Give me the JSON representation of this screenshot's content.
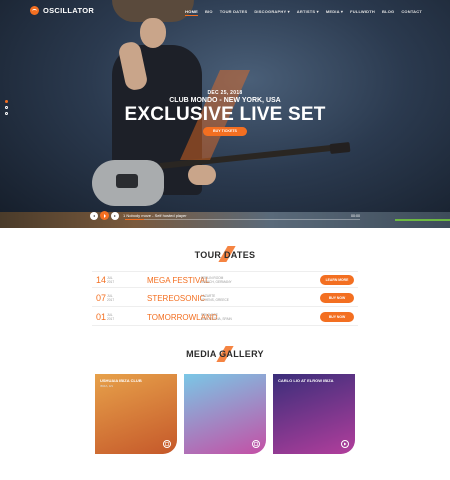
{
  "brand": {
    "name": "OSCILLATOR",
    "accent": "#f36f21"
  },
  "nav": {
    "items": [
      "HOME",
      "BIO",
      "TOUR DATES",
      "DISCOGRAPHY ▾",
      "ARTISTS ▾",
      "MEDIA ▾",
      "FULLWIDTH",
      "BLOG",
      "CONTACT"
    ],
    "active_index": 0
  },
  "hero": {
    "date": "DEC 25, 2018",
    "venue": "CLUB MONDO - NEW YORK, USA",
    "headline": "EXCLUSIVE LIVE SET",
    "cta": "BUY TICKETS",
    "slides": 3,
    "active_slide": 0
  },
  "player": {
    "track": "1 Nobody move - Self hosted player",
    "time": "00:00",
    "progress": 0.08
  },
  "tour": {
    "title": "TOUR DATES",
    "rows": [
      {
        "day": "14",
        "month": "JUL",
        "year": "2017",
        "name": "MEGA FESTIVAL",
        "location_line1": "BERLIN ROOM",
        "location_line2": "MUNICH, GERMANY",
        "button": "LEARN MORE"
      },
      {
        "day": "07",
        "month": "JUL",
        "year": "2017",
        "name": "STEREOSONIC",
        "location_line1": "LAZARTE",
        "location_line2": "ATHENS, GREECE",
        "button": "BUY NOW"
      },
      {
        "day": "01",
        "month": "JUL",
        "year": "2017",
        "name": "TOMORROWLAND",
        "location_line1": "PRIVILEGE",
        "location_line2": "BARCELONA, SPAIN",
        "button": "BUY NOW"
      }
    ]
  },
  "gallery": {
    "title": "MEDIA GALLERY",
    "cards": [
      {
        "title": "USHUAIA IBIZA CLUB",
        "sub": "IBIZA, ES",
        "icon": "gallery-icon",
        "colors": [
          "#e7a14a",
          "#c5582a"
        ]
      },
      {
        "title": "",
        "sub": "",
        "icon": "gallery-icon",
        "colors": [
          "#7ac7e6",
          "#c44fa5"
        ]
      },
      {
        "title": "CARLO LIO AT ELROW IBIZA",
        "sub": "",
        "icon": "play-icon",
        "colors": [
          "#3a2e7a",
          "#b23e9c"
        ]
      }
    ]
  }
}
